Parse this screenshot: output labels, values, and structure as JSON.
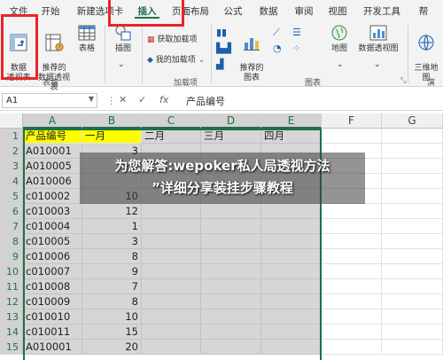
{
  "ribbon_tabs": [
    {
      "label": "文件",
      "active": false
    },
    {
      "label": "开始",
      "active": false
    },
    {
      "label": "新建选项卡",
      "active": false
    },
    {
      "label": "插入",
      "active": true
    },
    {
      "label": "页面布局",
      "active": false
    },
    {
      "label": "公式",
      "active": false
    },
    {
      "label": "数据",
      "active": false
    },
    {
      "label": "审阅",
      "active": false
    },
    {
      "label": "视图",
      "active": false
    },
    {
      "label": "开发工具",
      "active": false
    },
    {
      "label": "帮",
      "active": false
    }
  ],
  "ribbon": {
    "tables_group": {
      "label": "表格",
      "pivot_table": "数据\n透视表",
      "recommended_pivot": "推荐的\n数据透视表",
      "table": "表格"
    },
    "illustrations": {
      "label": "插图"
    },
    "addins_group": {
      "label": "加载项",
      "get_addins": "获取加载项",
      "my_addins": "我的加载项"
    },
    "charts_group": {
      "label": "图表",
      "recommended_charts": "推荐的\n图表",
      "map": "地图",
      "pivot_chart": "数据透视图"
    },
    "tours_group": {
      "label": "演",
      "map_3d": "三维地\n图"
    }
  },
  "formula_bar": {
    "name_box": "A1",
    "fx_label": "fx",
    "value": "产品编号"
  },
  "sheet": {
    "columns": [
      "A",
      "B",
      "C",
      "D",
      "E",
      "F",
      "G"
    ],
    "row_numbers": [
      "1",
      "2",
      "3",
      "4",
      "5",
      "6",
      "7",
      "8",
      "9",
      "10",
      "11",
      "12",
      "13",
      "14",
      "15"
    ],
    "header_row": [
      "产品编号",
      "一月",
      "二月",
      "三月",
      "四月"
    ],
    "rows": [
      {
        "a": "A010001",
        "b": "3"
      },
      {
        "a": "A010005",
        "b": ""
      },
      {
        "a": "A010006",
        "b": ""
      },
      {
        "a": "c010002",
        "b": "10"
      },
      {
        "a": "c010003",
        "b": "12"
      },
      {
        "a": "c010004",
        "b": "1"
      },
      {
        "a": "c010005",
        "b": "3"
      },
      {
        "a": "c010006",
        "b": "8"
      },
      {
        "a": "c010007",
        "b": "9"
      },
      {
        "a": "c010008",
        "b": "7"
      },
      {
        "a": "c010009",
        "b": "8"
      },
      {
        "a": "c010010",
        "b": "10"
      },
      {
        "a": "c010011",
        "b": "15"
      },
      {
        "a": "A010001",
        "b": "20"
      }
    ]
  },
  "banner": {
    "line1": "为您解答:wepoker私人局透视方法",
    "line2": "”详细分享装挂步骤教程"
  },
  "colors": {
    "accent": "#1e7145",
    "highlight_red": "#e8252a",
    "header_fill": "#ffff00",
    "selection": "#d6d6d6"
  }
}
